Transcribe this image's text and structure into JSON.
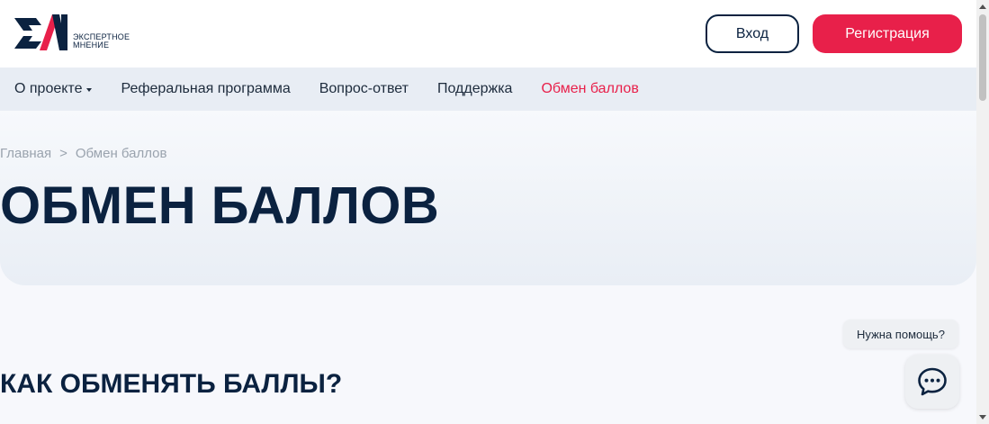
{
  "header": {
    "logo_line1": "ЭКСПЕРТНОЕ",
    "logo_line2": "МНЕНИЕ",
    "login_label": "Вход",
    "register_label": "Регистрация"
  },
  "nav": {
    "items": [
      {
        "label": "О проекте",
        "has_dropdown": true
      },
      {
        "label": "Реферальная программа"
      },
      {
        "label": "Вопрос-ответ"
      },
      {
        "label": "Поддержка"
      },
      {
        "label": "Обмен баллов",
        "active": true
      }
    ]
  },
  "breadcrumb": {
    "home": "Главная",
    "separator": ">",
    "current": "Обмен баллов"
  },
  "hero": {
    "title": "ОБМЕН БАЛЛОВ"
  },
  "section": {
    "title": "КАК ОБМЕНЯТЬ БАЛЛЫ?"
  },
  "help": {
    "bubble_text": "Нужна помощь?",
    "chat_icon": "chat-dots-icon"
  },
  "colors": {
    "accent": "#e8204a",
    "navy": "#0b2240",
    "nav_bg": "#e8edf4"
  }
}
